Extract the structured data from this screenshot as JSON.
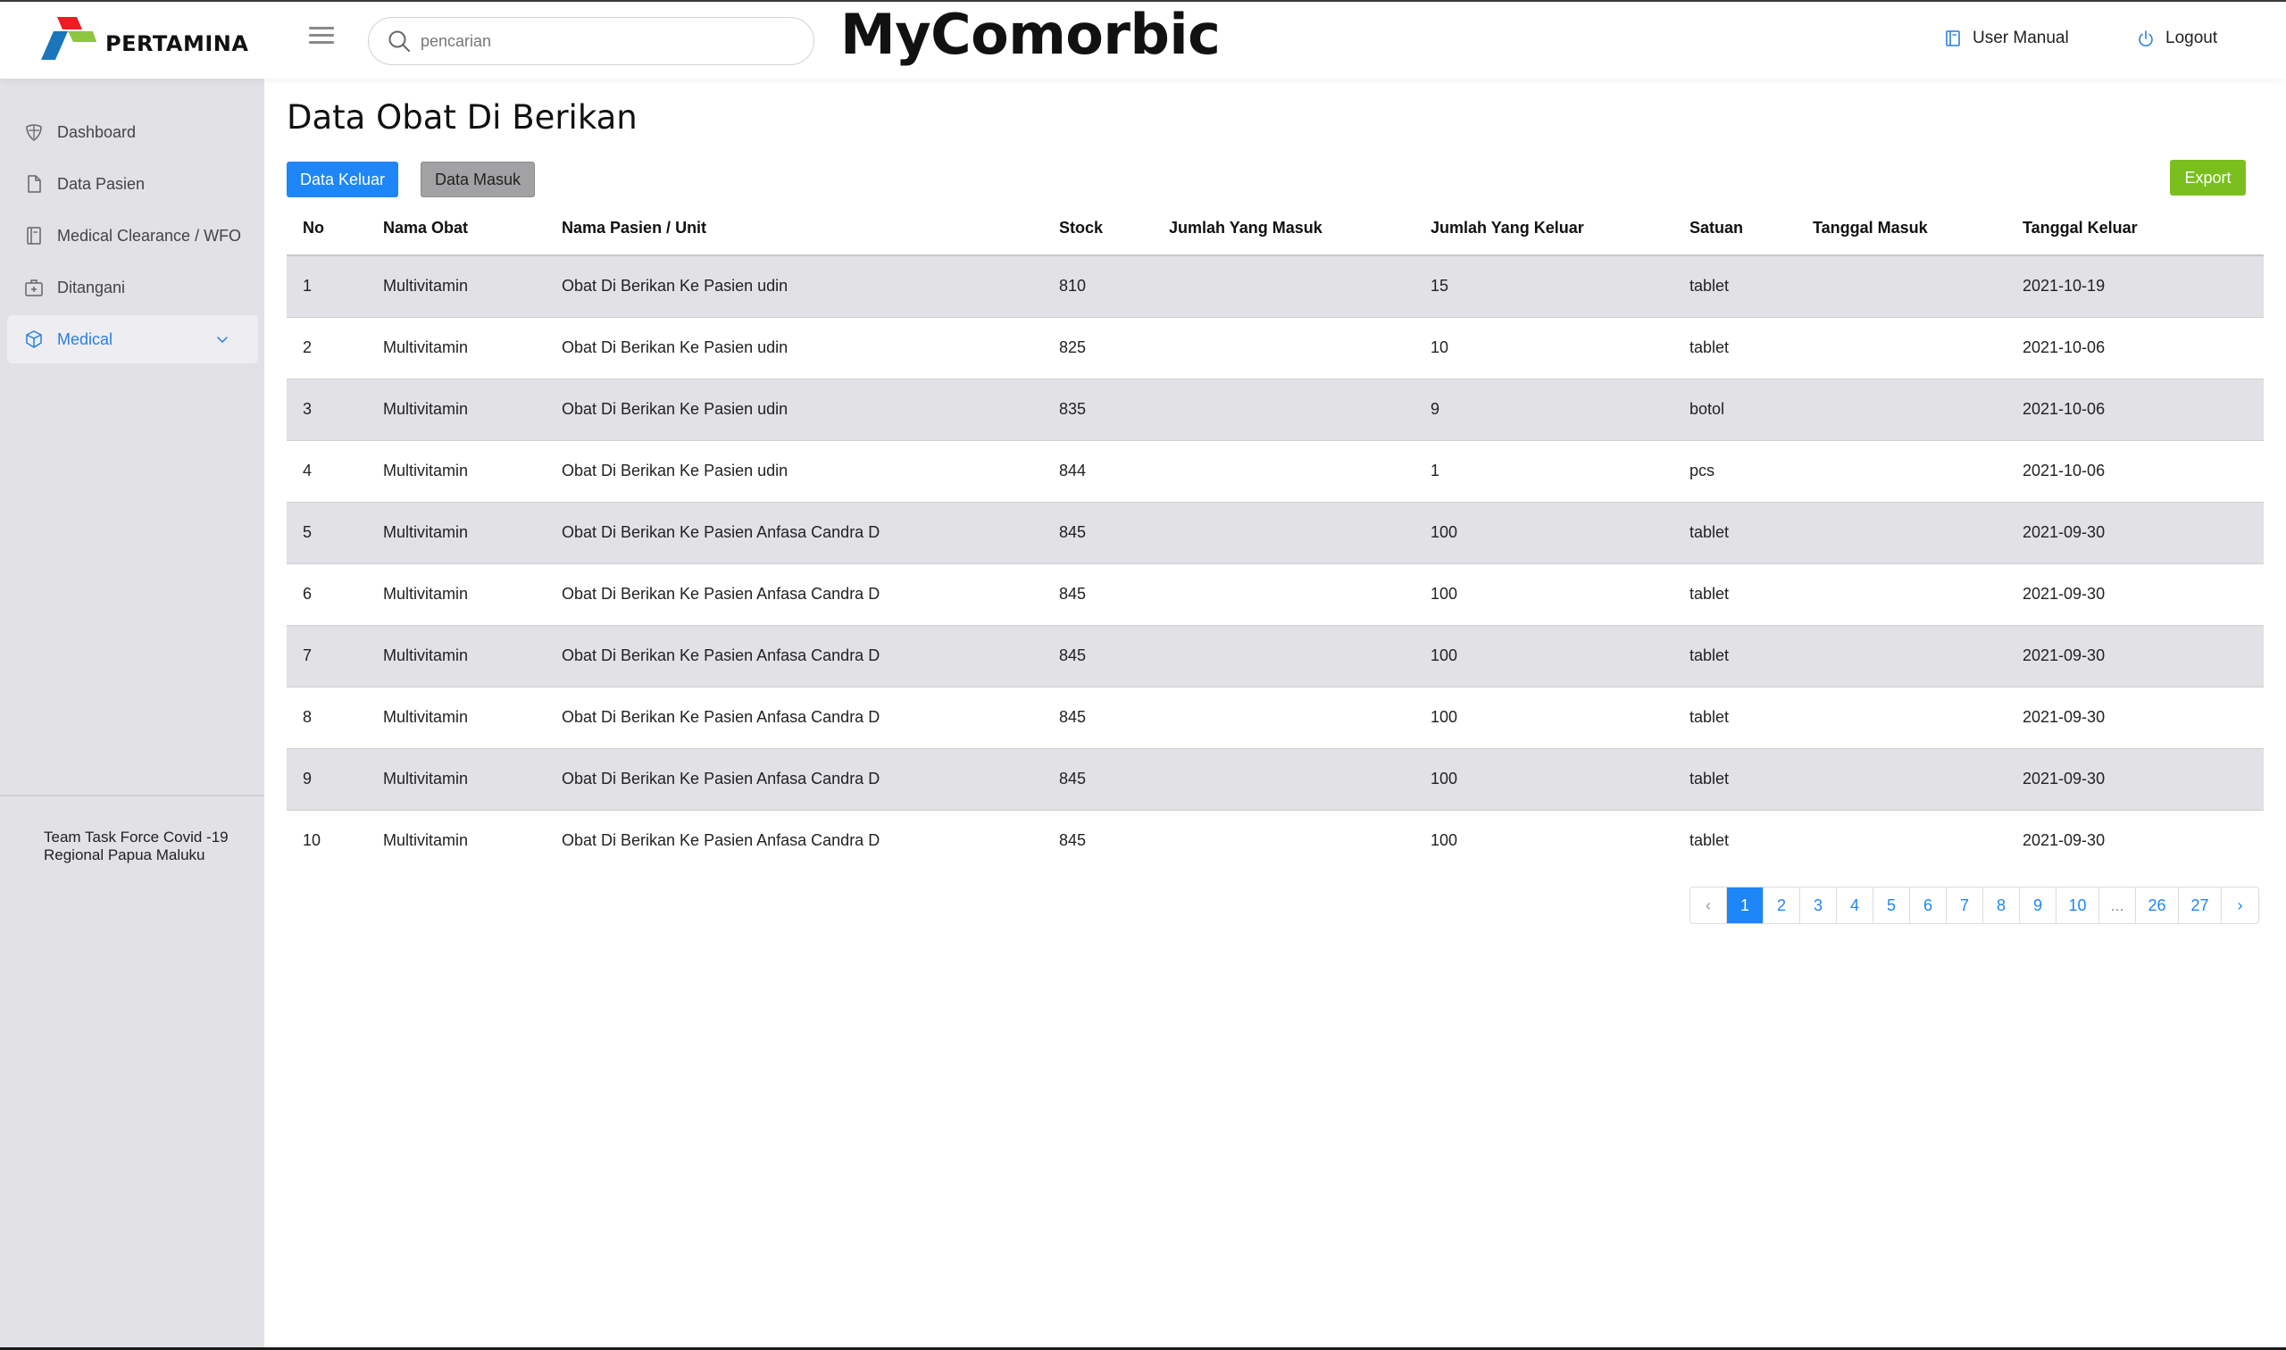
{
  "brand": {
    "name": "PERTAMINA"
  },
  "header": {
    "app_title": "MyComorbic",
    "search_placeholder": "pencarian",
    "user_manual": "User Manual",
    "logout": "Logout"
  },
  "sidebar": {
    "items": [
      {
        "label": "Dashboard",
        "icon": "shield-icon"
      },
      {
        "label": "Data Pasien",
        "icon": "document-icon"
      },
      {
        "label": "Medical Clearance / WFO",
        "icon": "book-icon"
      },
      {
        "label": "Ditangani",
        "icon": "medical-kit-icon"
      },
      {
        "label": "Medical",
        "icon": "box-icon",
        "active": true
      }
    ],
    "footer_line1": "Team Task Force Covid -19",
    "footer_line2": "Regional Papua Maluku"
  },
  "main": {
    "title": "Data Obat Di Berikan",
    "buttons": {
      "keluar": "Data Keluar",
      "masuk": "Data Masuk",
      "export": "Export"
    },
    "columns": [
      "No",
      "Nama Obat",
      "Nama Pasien / Unit",
      "Stock",
      "Jumlah Yang Masuk",
      "Jumlah Yang Keluar",
      "Satuan",
      "Tanggal Masuk",
      "Tanggal Keluar"
    ],
    "rows": [
      [
        "1",
        "Multivitamin",
        "Obat Di Berikan Ke Pasien udin",
        "810",
        "",
        "15",
        "tablet",
        "",
        "2021-10-19"
      ],
      [
        "2",
        "Multivitamin",
        "Obat Di Berikan Ke Pasien udin",
        "825",
        "",
        "10",
        "tablet",
        "",
        "2021-10-06"
      ],
      [
        "3",
        "Multivitamin",
        "Obat Di Berikan Ke Pasien udin",
        "835",
        "",
        "9",
        "botol",
        "",
        "2021-10-06"
      ],
      [
        "4",
        "Multivitamin",
        "Obat Di Berikan Ke Pasien udin",
        "844",
        "",
        "1",
        "pcs",
        "",
        "2021-10-06"
      ],
      [
        "5",
        "Multivitamin",
        "Obat Di Berikan Ke Pasien Anfasa Candra D",
        "845",
        "",
        "100",
        "tablet",
        "",
        "2021-09-30"
      ],
      [
        "6",
        "Multivitamin",
        "Obat Di Berikan Ke Pasien Anfasa Candra D",
        "845",
        "",
        "100",
        "tablet",
        "",
        "2021-09-30"
      ],
      [
        "7",
        "Multivitamin",
        "Obat Di Berikan Ke Pasien Anfasa Candra D",
        "845",
        "",
        "100",
        "tablet",
        "",
        "2021-09-30"
      ],
      [
        "8",
        "Multivitamin",
        "Obat Di Berikan Ke Pasien Anfasa Candra D",
        "845",
        "",
        "100",
        "tablet",
        "",
        "2021-09-30"
      ],
      [
        "9",
        "Multivitamin",
        "Obat Di Berikan Ke Pasien Anfasa Candra D",
        "845",
        "",
        "100",
        "tablet",
        "",
        "2021-09-30"
      ],
      [
        "10",
        "Multivitamin",
        "Obat Di Berikan Ke Pasien Anfasa Candra D",
        "845",
        "",
        "100",
        "tablet",
        "",
        "2021-09-30"
      ]
    ],
    "pagination": {
      "prev": "‹",
      "pages": [
        "1",
        "2",
        "3",
        "4",
        "5",
        "6",
        "7",
        "8",
        "9",
        "10",
        "...",
        "26",
        "27"
      ],
      "current": "1",
      "next": "›"
    }
  },
  "colors": {
    "primary": "#1e86f7",
    "export": "#7abf1e",
    "sidebar_bg": "#e1e1e6",
    "active_nav": "#2a7fe0"
  }
}
